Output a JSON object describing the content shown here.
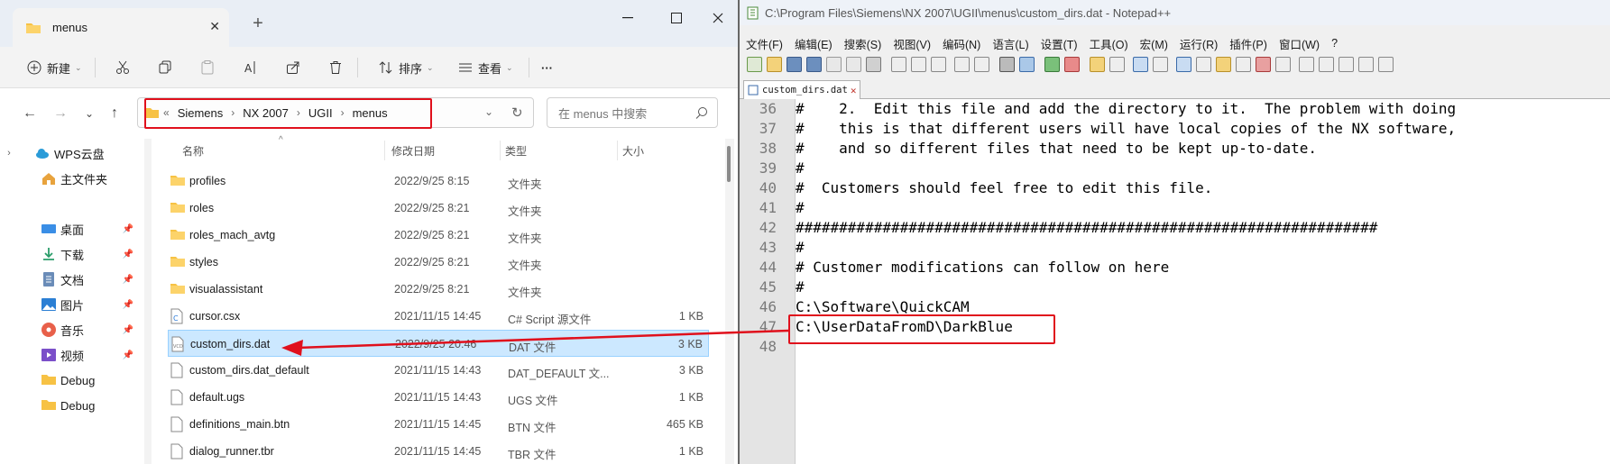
{
  "explorer": {
    "tab_title": "menus",
    "toolbar": {
      "new_label": "新建",
      "sort_label": "排序",
      "view_label": "查看",
      "more_label": "···"
    },
    "breadcrumb": [
      "Siemens",
      "NX 2007",
      "UGII",
      "menus"
    ],
    "search_placeholder": "在 menus 中搜索",
    "sidebar": [
      {
        "label": "WPS云盘",
        "icon": "cloud-icon",
        "pinned": false,
        "expandable": true
      },
      {
        "label": "主文件夹",
        "icon": "home-icon",
        "pinned": false,
        "expandable": false
      },
      {
        "label": "桌面",
        "icon": "desktop-icon",
        "pinned": true
      },
      {
        "label": "下载",
        "icon": "download-icon",
        "pinned": true
      },
      {
        "label": "文档",
        "icon": "documents-icon",
        "pinned": true
      },
      {
        "label": "图片",
        "icon": "pictures-icon",
        "pinned": true
      },
      {
        "label": "音乐",
        "icon": "music-icon",
        "pinned": true
      },
      {
        "label": "视频",
        "icon": "videos-icon",
        "pinned": true
      },
      {
        "label": "Debug",
        "icon": "folder-icon",
        "pinned": false
      },
      {
        "label": "Debug",
        "icon": "folder-icon",
        "pinned": false
      }
    ],
    "columns": {
      "name": "名称",
      "date": "修改日期",
      "type": "类型",
      "size": "大小"
    },
    "files": [
      {
        "name": "profiles",
        "date": "2022/9/25 8:15",
        "type": "文件夹",
        "size": "",
        "icon": "folder-icon"
      },
      {
        "name": "roles",
        "date": "2022/9/25 8:21",
        "type": "文件夹",
        "size": "",
        "icon": "folder-icon"
      },
      {
        "name": "roles_mach_avtg",
        "date": "2022/9/25 8:21",
        "type": "文件夹",
        "size": "",
        "icon": "folder-icon"
      },
      {
        "name": "styles",
        "date": "2022/9/25 8:21",
        "type": "文件夹",
        "size": "",
        "icon": "folder-icon"
      },
      {
        "name": "visualassistant",
        "date": "2022/9/25 8:21",
        "type": "文件夹",
        "size": "",
        "icon": "folder-icon"
      },
      {
        "name": "cursor.csx",
        "date": "2021/11/15 14:45",
        "type": "C# Script 源文件",
        "size": "1 KB",
        "icon": "csharp-file-icon"
      },
      {
        "name": "custom_dirs.dat",
        "date": "2022/9/25 20:46",
        "type": "DAT 文件",
        "size": "3 KB",
        "icon": "dat-file-icon",
        "selected": true
      },
      {
        "name": "custom_dirs.dat_default",
        "date": "2021/11/15 14:43",
        "type": "DAT_DEFAULT 文...",
        "size": "3 KB",
        "icon": "file-icon"
      },
      {
        "name": "default.ugs",
        "date": "2021/11/15 14:43",
        "type": "UGS 文件",
        "size": "1 KB",
        "icon": "file-icon"
      },
      {
        "name": "definitions_main.btn",
        "date": "2021/11/15 14:45",
        "type": "BTN 文件",
        "size": "465 KB",
        "icon": "file-icon"
      },
      {
        "name": "dialog_runner.tbr",
        "date": "2021/11/15 14:45",
        "type": "TBR 文件",
        "size": "1 KB",
        "icon": "file-icon"
      }
    ]
  },
  "notepad": {
    "title": "C:\\Program Files\\Siemens\\NX 2007\\UGII\\menus\\custom_dirs.dat - Notepad++",
    "menu": [
      "文件(F)",
      "编辑(E)",
      "搜索(S)",
      "视图(V)",
      "编码(N)",
      "语言(L)",
      "设置(T)",
      "工具(O)",
      "宏(M)",
      "运行(R)",
      "插件(P)",
      "窗口(W)",
      "?"
    ],
    "tab_label": "custom_dirs.dat",
    "lines": [
      {
        "n": "36",
        "text": "#    2.  Edit this file and add the directory to it.  The problem with doing"
      },
      {
        "n": "37",
        "text": "#    this is that different users will have local copies of the NX software,"
      },
      {
        "n": "38",
        "text": "#    and so different files that need to be kept up-to-date."
      },
      {
        "n": "39",
        "text": "#"
      },
      {
        "n": "40",
        "text": "#  Customers should feel free to edit this file."
      },
      {
        "n": "41",
        "text": "#"
      },
      {
        "n": "42",
        "text": "###################################################################"
      },
      {
        "n": "43",
        "text": "#"
      },
      {
        "n": "44",
        "text": "# Customer modifications can follow on here"
      },
      {
        "n": "45",
        "text": "#"
      },
      {
        "n": "46",
        "text": "C:\\Software\\QuickCAM"
      },
      {
        "n": "47",
        "text": "C:\\UserDataFromD\\DarkBlue"
      },
      {
        "n": "48",
        "text": ""
      }
    ]
  },
  "colors": {
    "annotation_red": "#e0101c",
    "selection_blue": "#cce8ff",
    "folder_yellow": "#f7c244"
  }
}
